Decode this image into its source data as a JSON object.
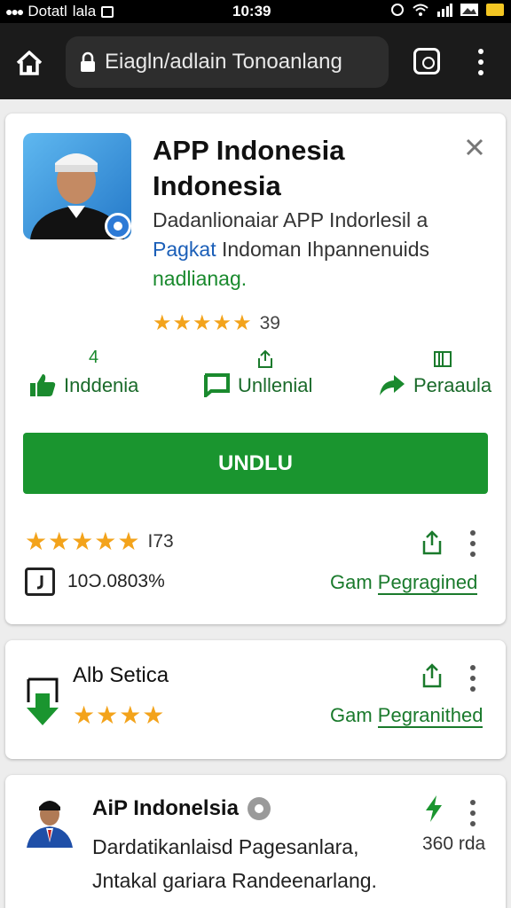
{
  "status_bar": {
    "carrier": "Dotatl",
    "carrier2": "lala",
    "time": "10:39"
  },
  "browser": {
    "url": "Eiagln/adlain Tonoanlang"
  },
  "app_card": {
    "title_line1": "APP Indonesia",
    "title_line2": "Indonesia",
    "desc_line1": "Dadanlionaiar APP Indorlesil a",
    "desc_blue": "Pagkat",
    "desc_line2_rest": " Indoman Ihpannenuids",
    "desc_line3": "nadlianag.",
    "rating_stars": "★★★★★",
    "rating_count": "39",
    "actions": [
      {
        "label": "Inddenia",
        "num": "4"
      },
      {
        "label": "Unllenial",
        "num": ""
      },
      {
        "label": "Peraaula",
        "num": ""
      }
    ],
    "install_label": "UNDLU",
    "row_rating_stars": "★★★★★",
    "row_rating_count": "I73",
    "size_text": "10Ͻ.0803%",
    "link_prefix": "Gam ",
    "link_text": "Pegragined"
  },
  "card2": {
    "title": "Alb Setica",
    "stars": "★★★★",
    "link_prefix": "Gam ",
    "link_text": "Pegranithed"
  },
  "card3": {
    "title": "AiP Indonelsia",
    "desc_line1": "Dardatikanlaisd Pagesanlara,",
    "desc_line2": "Jntakal gariara Randeenarlang.",
    "size": "360 rda"
  },
  "colors": {
    "accent_green": "#1a952f",
    "star_gold": "#f3a31b",
    "link_blue": "#1b5fb8",
    "browser_dark": "#1b1b1b"
  }
}
